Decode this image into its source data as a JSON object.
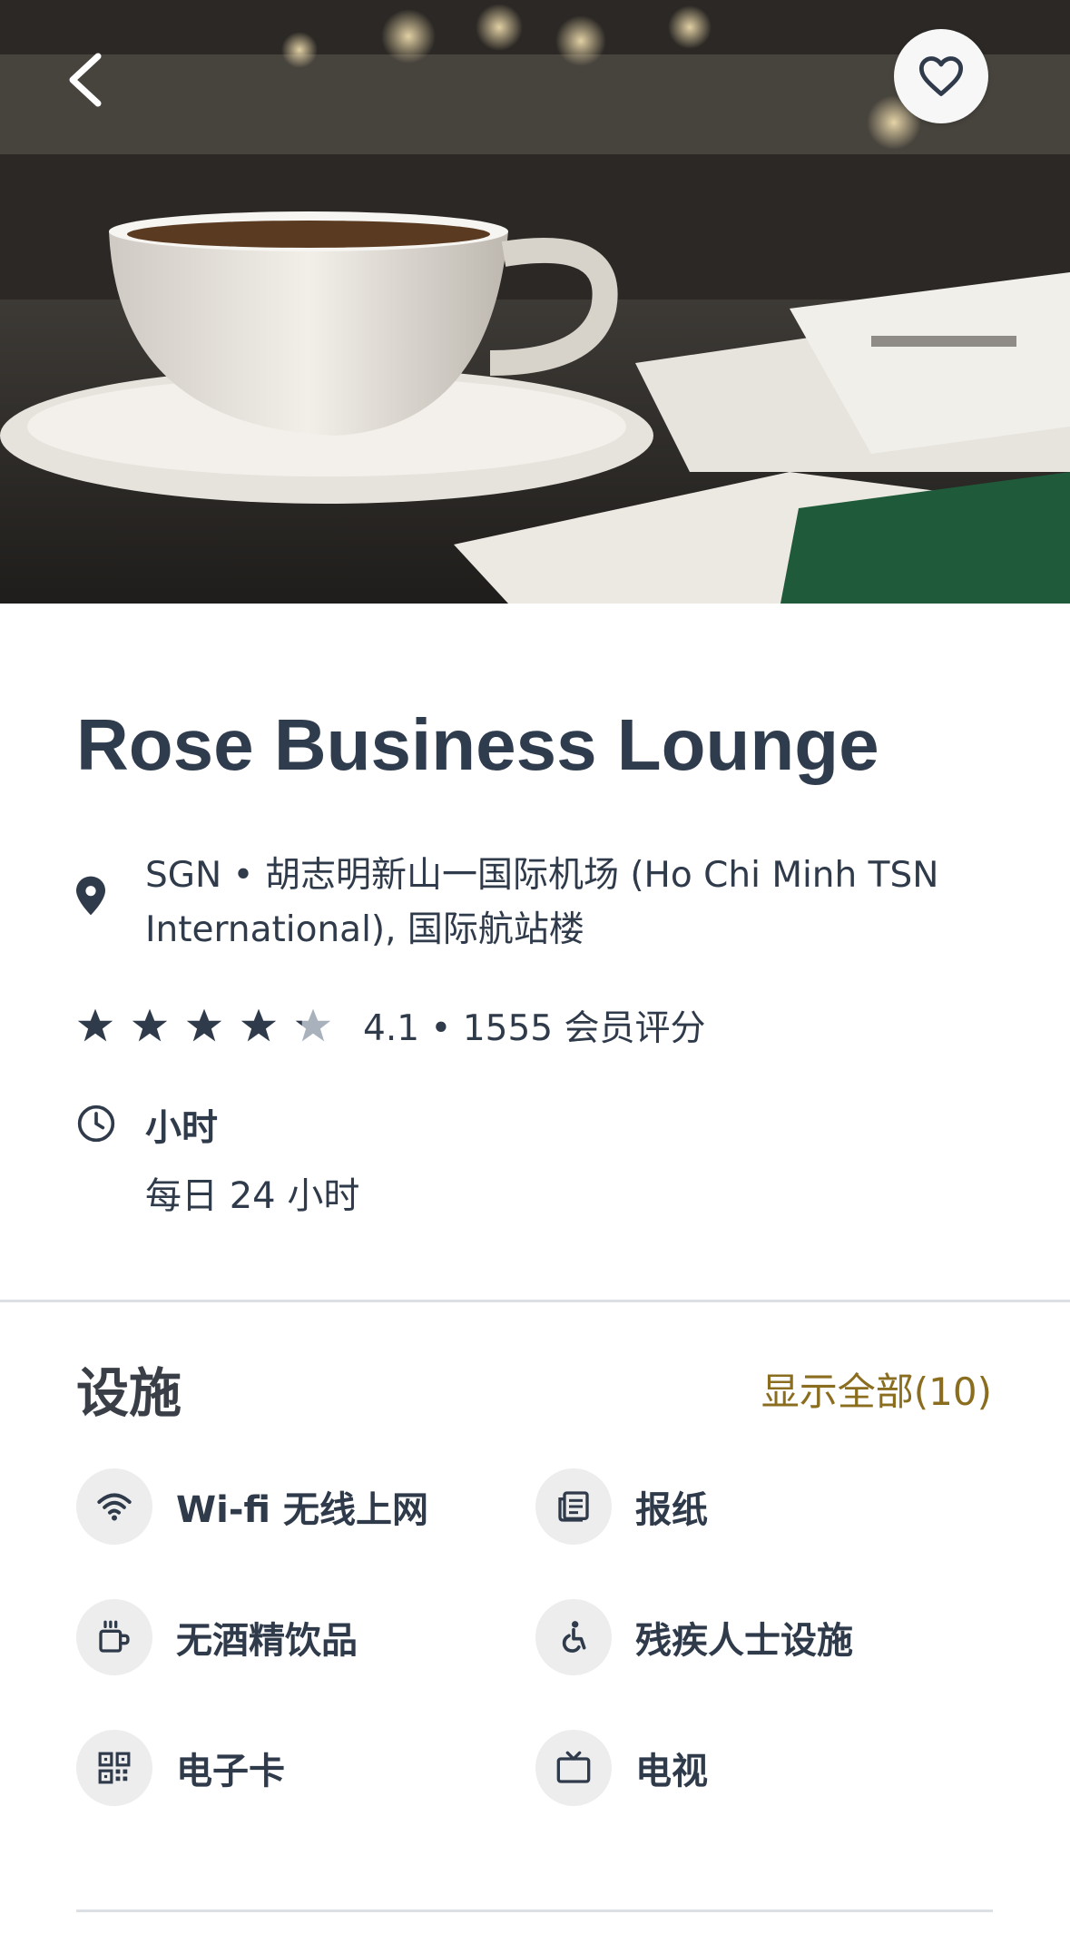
{
  "hero": {
    "back_icon": "chevron-left-icon",
    "favorite_icon": "heart-icon"
  },
  "lounge": {
    "name": "Rose Business Lounge",
    "location_icon": "map-pin-icon",
    "location": "SGN • 胡志明新山一国际机场 (Ho Chi Minh TSN International), 国际航站楼",
    "rating": 4.1,
    "rating_text": "4.1 • 1555 会员评分",
    "stars_full": 4,
    "stars_total": 5,
    "hours_icon": "clock-icon",
    "hours_label": "小时",
    "hours_value": "每日 24 小时"
  },
  "facilities": {
    "title": "设施",
    "show_all": "显示全部(10)",
    "items": [
      {
        "label": "Wi-fi 无线上网",
        "icon": "wifi-icon"
      },
      {
        "label": "报纸",
        "icon": "newspaper-icon"
      },
      {
        "label": "无酒精饮品",
        "icon": "cup-icon"
      },
      {
        "label": "残疾人士设施",
        "icon": "accessibility-icon"
      },
      {
        "label": "电子卡",
        "icon": "qr-code-icon"
      },
      {
        "label": "电视",
        "icon": "tv-icon"
      }
    ]
  },
  "colors": {
    "title": "#2f3c4e",
    "text": "#2f3a4a",
    "accent": "#8a6d1e",
    "star_full": "#2f3a4a",
    "star_empty": "#a9b2bc",
    "icon_bg": "#ededee"
  }
}
